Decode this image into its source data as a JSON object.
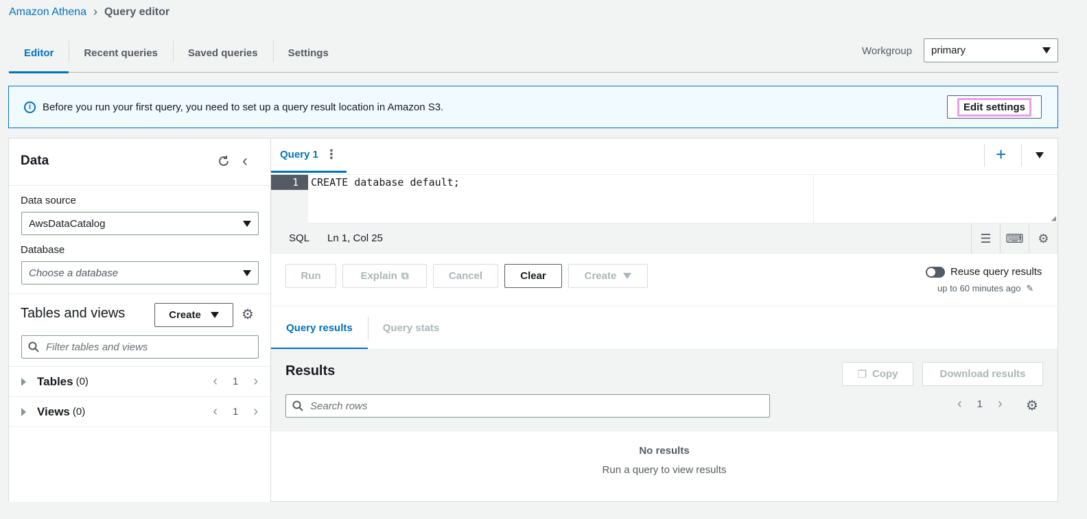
{
  "breadcrumb": {
    "root": "Amazon Athena",
    "current": "Query editor"
  },
  "tabs": [
    "Editor",
    "Recent queries",
    "Saved queries",
    "Settings"
  ],
  "workgroup": {
    "label": "Workgroup",
    "value": "primary"
  },
  "banner": {
    "message": "Before you run your first query, you need to set up a query result location in Amazon S3.",
    "button": "Edit settings"
  },
  "left_panel": {
    "title": "Data",
    "data_source_label": "Data source",
    "data_source_value": "AwsDataCatalog",
    "database_label": "Database",
    "database_placeholder": "Choose a database",
    "tables_views_title": "Tables and views",
    "create_button": "Create",
    "filter_placeholder": "Filter tables and views",
    "tables": {
      "name": "Tables",
      "count": "(0)",
      "page": "1"
    },
    "views": {
      "name": "Views",
      "count": "(0)",
      "page": "1"
    }
  },
  "editor": {
    "tab_label": "Query 1",
    "line_number": "1",
    "code": "CREATE database default;",
    "language": "SQL",
    "cursor": "Ln 1, Col 25"
  },
  "toolbar": {
    "run": "Run",
    "explain": "Explain",
    "cancel": "Cancel",
    "clear": "Clear",
    "create": "Create",
    "reuse_label": "Reuse query results",
    "reuse_sub": "up to 60 minutes ago"
  },
  "results": {
    "tabs": [
      "Query results",
      "Query stats"
    ],
    "title": "Results",
    "copy": "Copy",
    "download": "Download results",
    "search_placeholder": "Search rows",
    "page": "1",
    "empty_title": "No results",
    "empty_sub": "Run a query to view results"
  },
  "colors": {
    "accent": "#0073bb",
    "highlight": "#ea9cf0"
  }
}
